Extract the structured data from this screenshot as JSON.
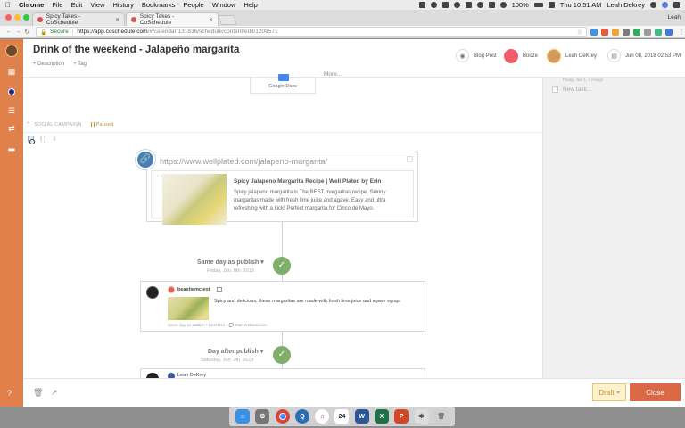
{
  "menubar": {
    "apple": "",
    "app_name": "Chrome",
    "items": [
      "File",
      "Edit",
      "View",
      "History",
      "Bookmarks",
      "People",
      "Window",
      "Help"
    ],
    "battery": "100%",
    "clock": "Thu 10:51 AM",
    "user": "Leah Dekrey"
  },
  "browser": {
    "tabs": [
      {
        "title": "Spicy Takes - CoSchedule",
        "active": false
      },
      {
        "title": "Spicy Takes - CoSchedule",
        "active": true
      }
    ],
    "tab_user": "Leah",
    "secure_label": "Secure",
    "url_host": "https://app.coschedule.com",
    "url_path": "/#/calendar/131836/schedule/content/edit/1208571"
  },
  "header": {
    "title": "Drink of the weekend -  Jalapeño margarita",
    "description_link": "+ Description",
    "tag_link": "+ Tag",
    "type": "Blog Post",
    "category": "Booze",
    "owner": "Leah DeKrey",
    "date": "Jun 08, 2018 02:53 PM"
  },
  "right_panel": {
    "date_hint": "Friday, Jun 1,  + Assign",
    "new_task_placeholder": "New task..."
  },
  "attachments": {
    "google_docs_label": "Google Docs",
    "more_label": "More..."
  },
  "social": {
    "section_label": "SOCIAL CAMPAIGN",
    "status": "Paused",
    "braces": "{ }",
    "link_url": "https://www.wellplated.com/jalapeno-margarita/",
    "link_title": "Spicy Jalapeno Margarita Recipe | Well Plated by Erin",
    "link_desc": "Spicy jalapeno margarita is The BEST margaritas recipe. Skinny margaritas made with fresh lime juice and agave. Easy and ultra refreshing with a kick! Perfect margarita for Cinco de Mayo.",
    "steps": [
      {
        "label": "Same day as publish",
        "date": "Friday, Jun. 8th, 2018"
      },
      {
        "label": "Day after publish",
        "date": "Saturday, Jun. 9th, 2018"
      }
    ],
    "post": {
      "user": "beastiemctest",
      "text": "Spicy and delicious, these margaritas are made with fresh lime juice and agave syrup.",
      "footer": "Same day as publish • Best time • 💬 Start A Discussion"
    },
    "post2_user": "Leah DeKrey"
  },
  "footer": {
    "draft_label": "Draft",
    "close_label": "Close"
  },
  "colors": {
    "sidebar": "#e0804b",
    "close_button": "#d96a45",
    "draft_bg": "#fdf2cf",
    "check_green": "#7fad6a",
    "link_pin": "#4a7fb3"
  },
  "dock_apps": [
    "finder",
    "system-preferences",
    "chrome",
    "quicktime",
    "itunes",
    "calendar",
    "word",
    "excel",
    "powerpoint",
    "photos",
    "trash"
  ]
}
